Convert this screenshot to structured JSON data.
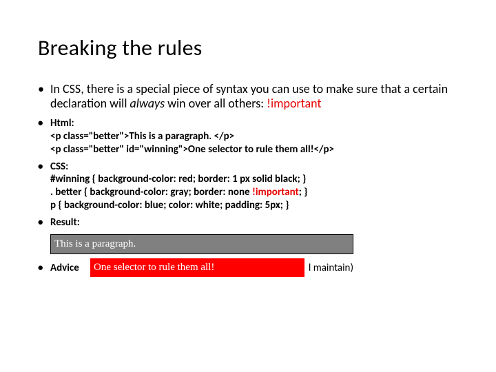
{
  "title": "Breaking the rules",
  "intro": {
    "prefix": "In CSS, there is a special piece of syntax you can use to make sure that a certain declaration will ",
    "always": "always",
    "mid": " win over all others: ",
    "important": "!important"
  },
  "items": {
    "html_label": "Html:",
    "html_line1": "<p class=\"better\">This is a paragraph. </p>",
    "html_line2": "<p class=\"better\" id=\"winning\">One selector to rule them all!</p>",
    "css_label": "CSS:",
    "css_line1": "#winning { background-color: red; border: 1 px solid black; }",
    "css_line2_pre": ". better { background-color: gray; border: none ",
    "css_line2_imp": "!important",
    "css_line2_post": "; }",
    "css_line3": "p { background-color: blue; color: white; padding: 5px; }",
    "result_label": "Result:",
    "advice_label": "Advice"
  },
  "result": {
    "p1": "This is a paragraph.",
    "p2": "One selector to rule them all!"
  },
  "advice_tail": "l maintain)"
}
